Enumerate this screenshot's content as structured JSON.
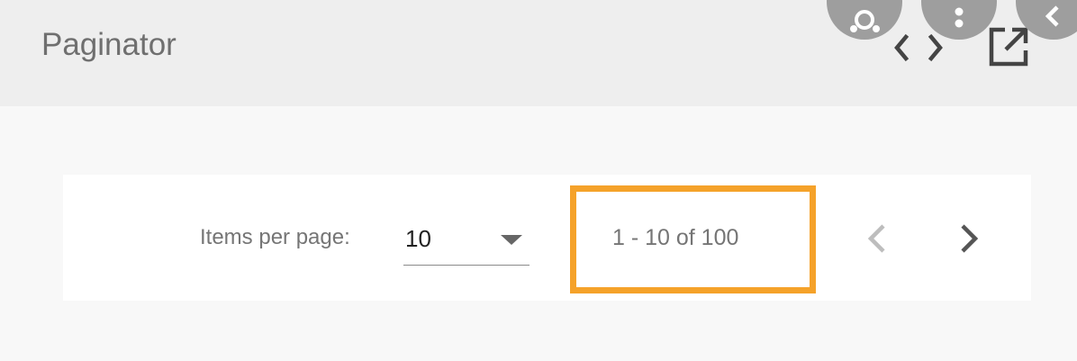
{
  "header": {
    "title": "Paginator",
    "icons": [
      "code-icon",
      "open-in-new-icon"
    ]
  },
  "overlay_buttons": [
    "lens-icon",
    "more-vert-icon",
    "back-icon"
  ],
  "paginator": {
    "items_per_page_label": "Items per page:",
    "page_size": "10",
    "range_label": "1 - 10 of 100",
    "highlight_color": "#f5a22a"
  },
  "colors": {
    "header_bg": "#eeeeee",
    "page_bg": "#f8f8f8",
    "card_bg": "#ffffff",
    "highlight": "#f5a22a"
  }
}
